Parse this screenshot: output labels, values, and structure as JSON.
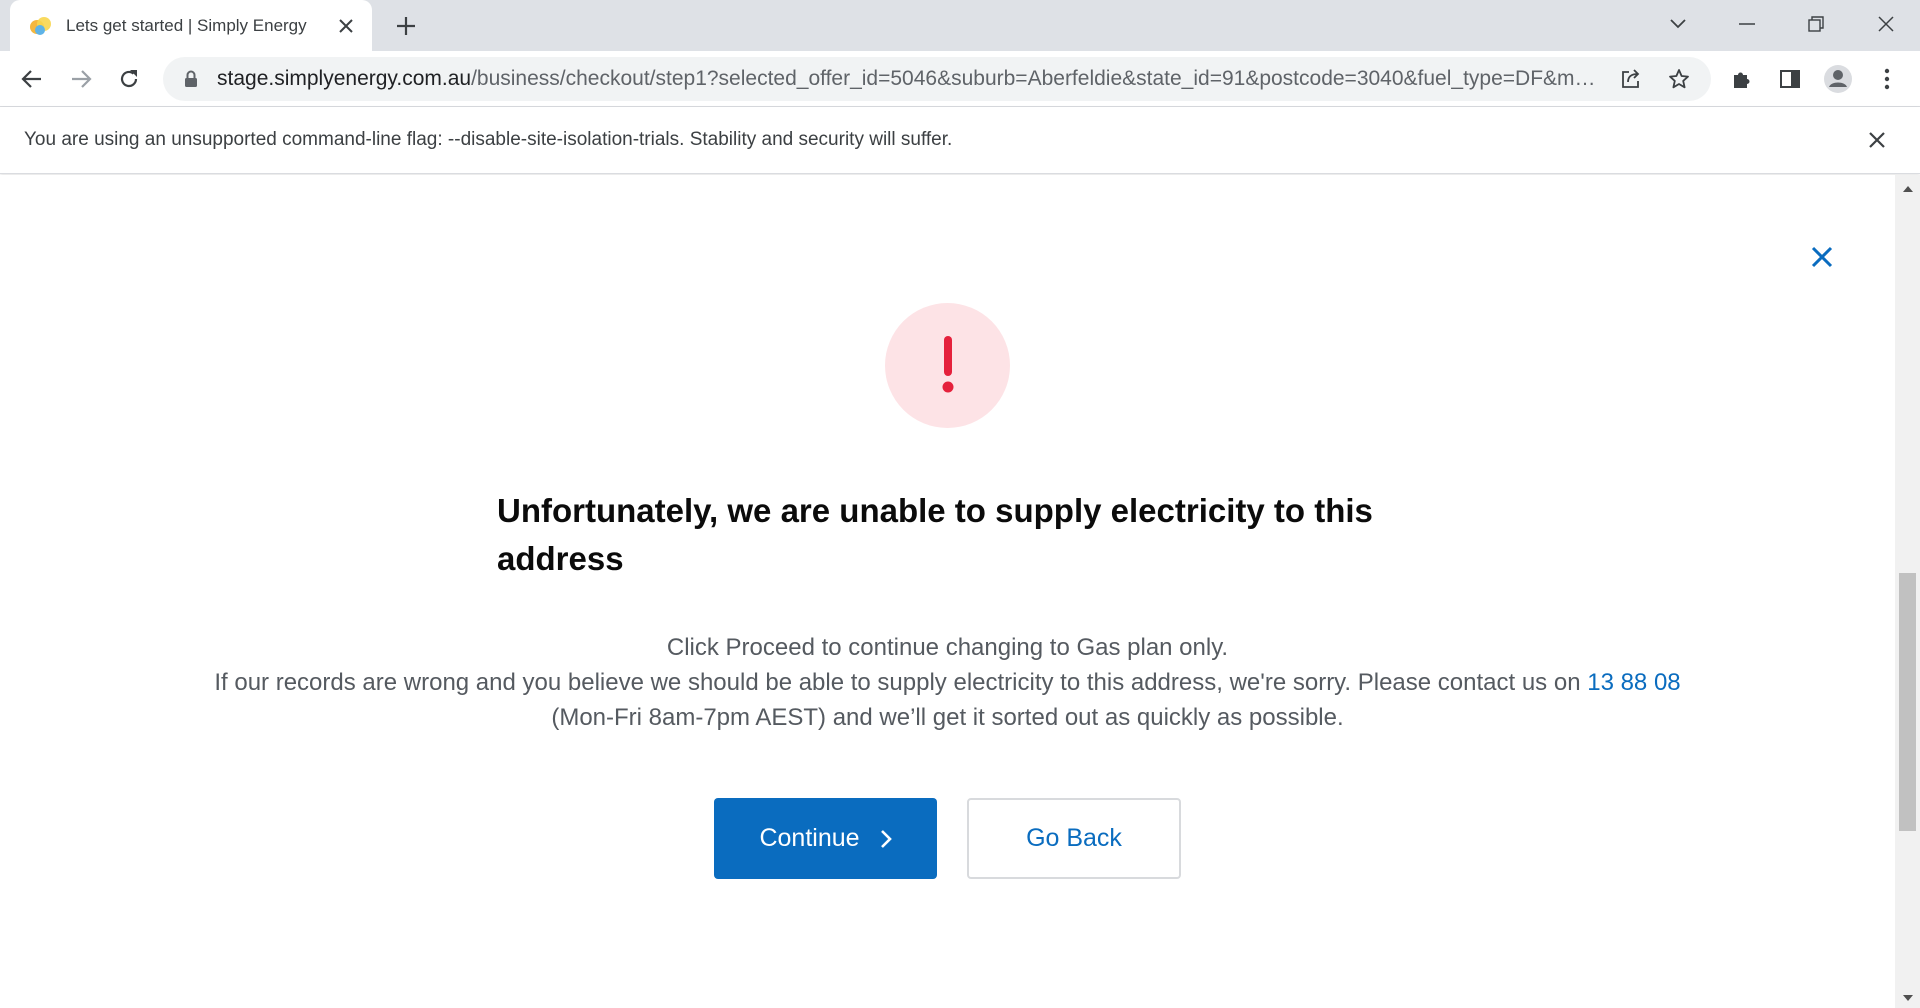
{
  "browser": {
    "tab": {
      "title": "Lets get started | Simply Energy",
      "favicon": "simply-energy-favicon"
    },
    "url": {
      "host": "stage.simplyenergy.com.au",
      "path": "/business/checkout/step1?selected_offer_id=5046&suburb=Aberfeldie&state_id=91&postcode=3040&fuel_type=DF&ma..."
    },
    "infobar": {
      "message": "You are using an unsupported command-line flag: --disable-site-isolation-trials. Stability and security will suffer."
    }
  },
  "modal": {
    "heading": "Unfortunately, we are unable to supply electricity to this address",
    "line1": "Click Proceed to continue changing to Gas plan only.",
    "line2_before": "If our records are wrong and you believe we should be able to supply electricity to this address, we're sorry. Please contact us on ",
    "phone": "13 88 08",
    "line2_after": " (Mon-Fri 8am-7pm AEST) and we’ll get it sorted out as quickly as possible.",
    "continue_label": "Continue",
    "back_label": "Go Back"
  },
  "colors": {
    "brand_blue": "#0a6cbf",
    "alert_red": "#e5213c",
    "alert_bg": "#fde3e6"
  }
}
